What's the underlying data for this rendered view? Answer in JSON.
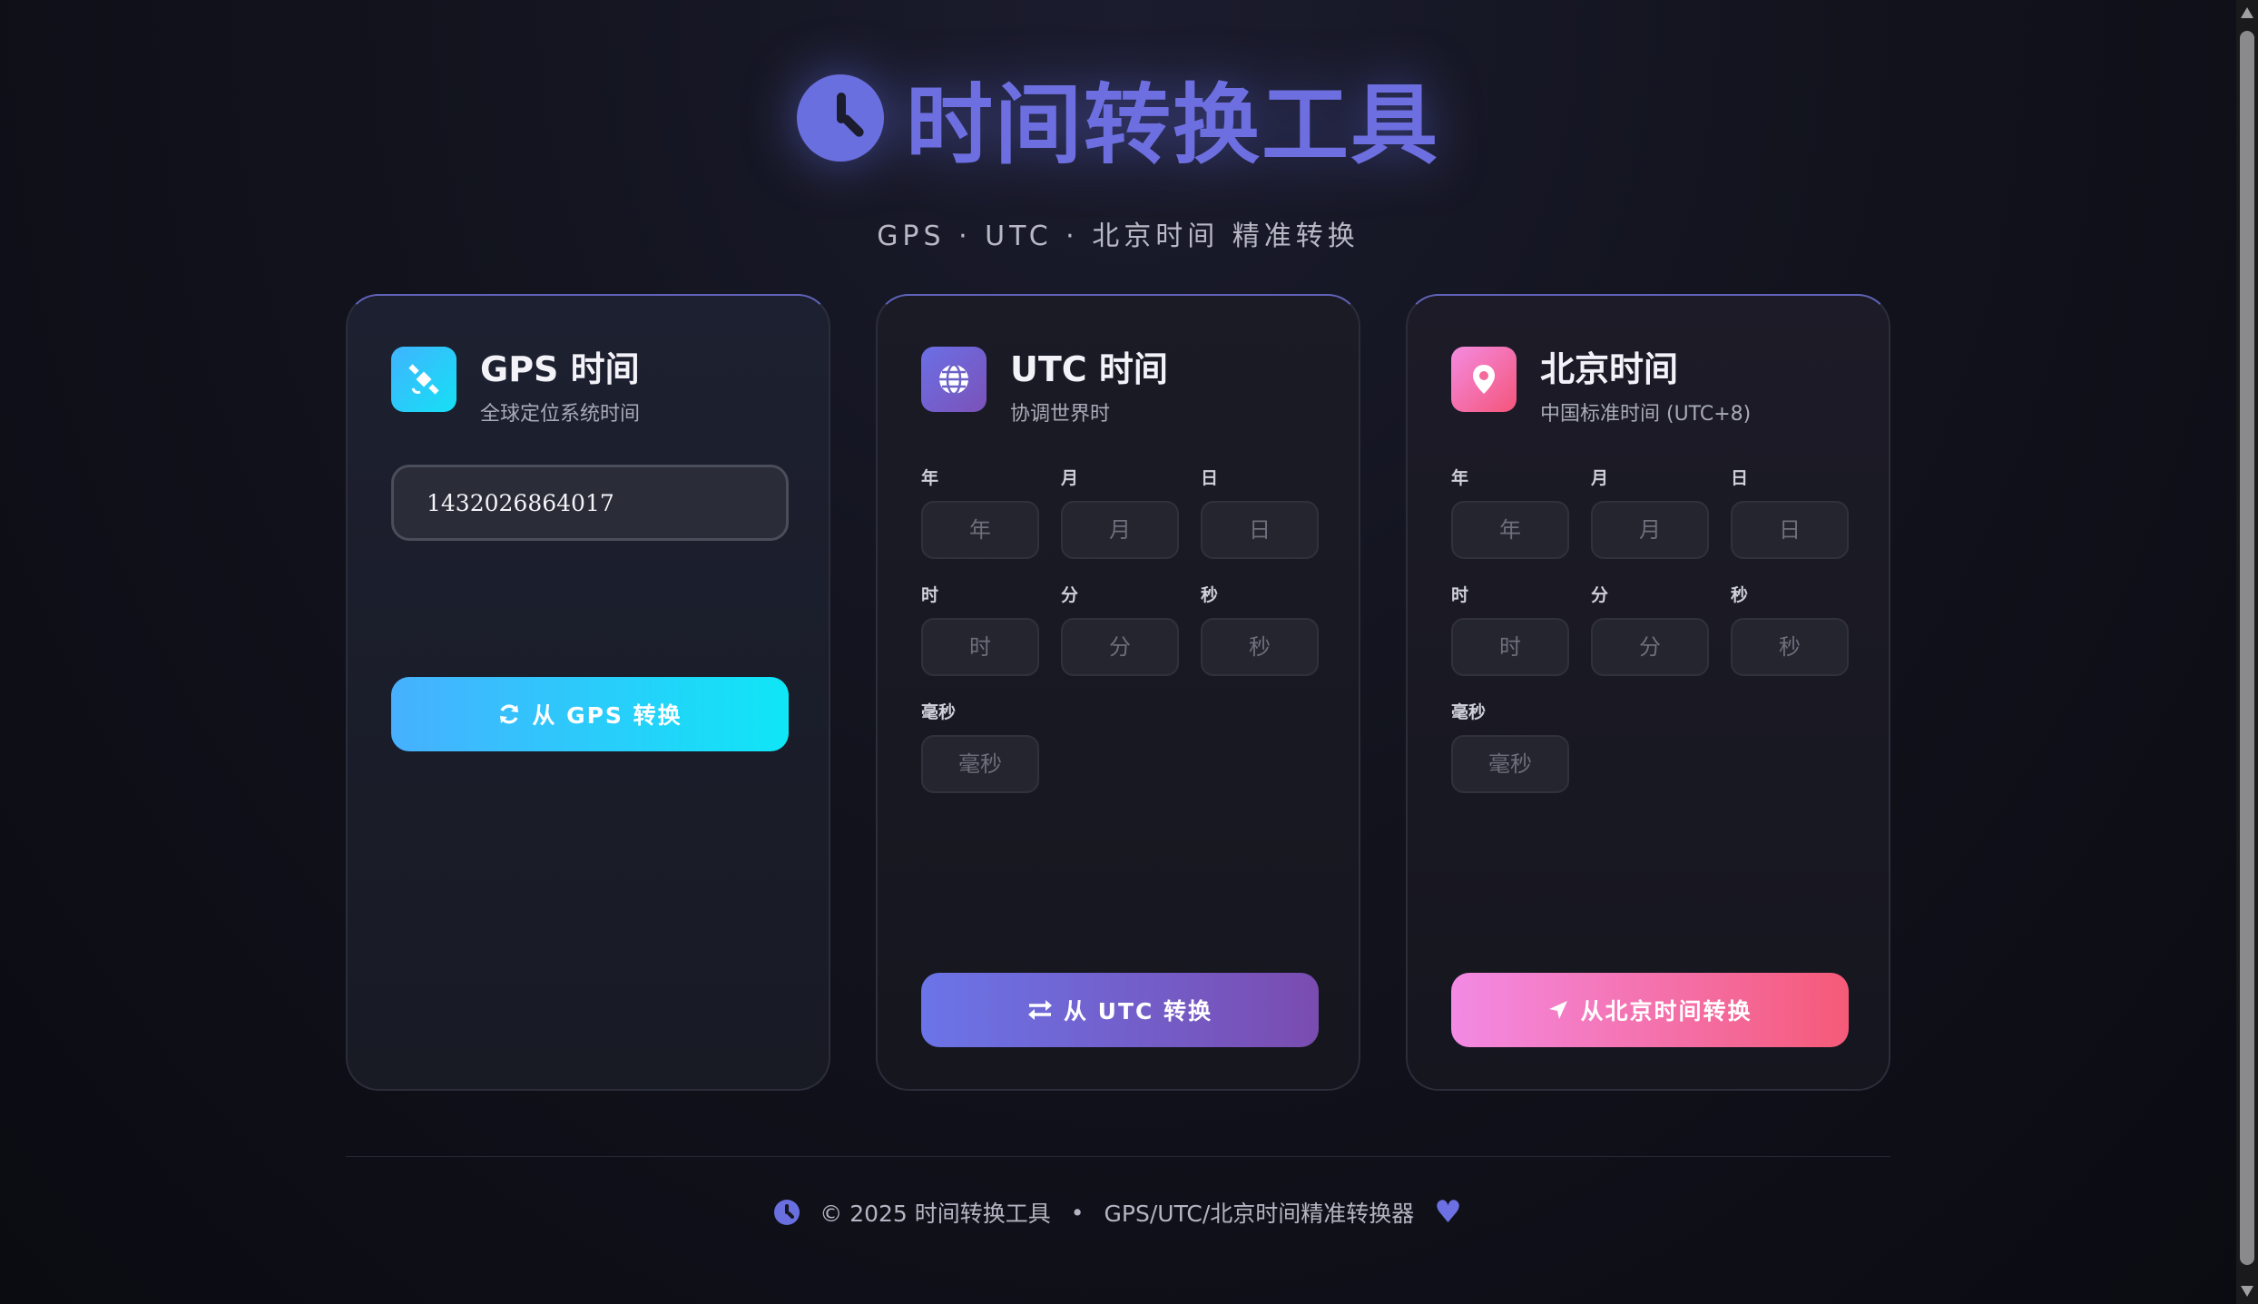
{
  "header": {
    "title": "时间转换工具",
    "subtitle": "GPS · UTC · 北京时间 精准转换"
  },
  "gps_card": {
    "title": "GPS 时间",
    "subtitle": "全球定位系统时间",
    "input_value": "1432026864017",
    "button_label": "从 GPS 转换",
    "icon": "satellite-icon"
  },
  "utc_card": {
    "title": "UTC 时间",
    "subtitle": "协调世界时",
    "icon": "globe-icon",
    "labels": {
      "year": "年",
      "month": "月",
      "day": "日",
      "hour": "时",
      "minute": "分",
      "second": "秒",
      "ms": "毫秒"
    },
    "placeholders": {
      "year": "年",
      "month": "月",
      "day": "日",
      "hour": "时",
      "minute": "分",
      "second": "秒",
      "ms": "毫秒"
    },
    "button_label": "从 UTC 转换"
  },
  "bj_card": {
    "title": "北京时间",
    "subtitle": "中国标准时间 (UTC+8)",
    "icon": "map-pin-icon",
    "labels": {
      "year": "年",
      "month": "月",
      "day": "日",
      "hour": "时",
      "minute": "分",
      "second": "秒",
      "ms": "毫秒"
    },
    "placeholders": {
      "year": "年",
      "month": "月",
      "day": "日",
      "hour": "时",
      "minute": "分",
      "second": "秒",
      "ms": "毫秒"
    },
    "button_label": "从北京时间转换"
  },
  "footer": {
    "copyright": "© 2025 时间转换工具",
    "separator": "•",
    "tagline": "GPS/UTC/北京时间精准转换器"
  },
  "colors": {
    "accent": "#6c70e2",
    "gps_gradient": [
      "#47b0ff",
      "#0fe6f6"
    ],
    "utc_gradient": [
      "#6b74e8",
      "#7a4cb0"
    ],
    "bj_gradient": [
      "#f38ae4",
      "#f55a78"
    ]
  }
}
